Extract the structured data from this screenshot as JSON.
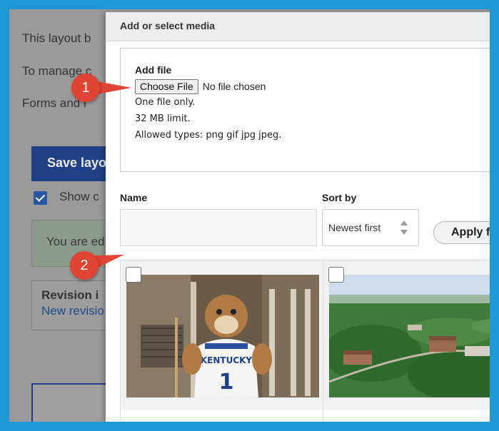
{
  "background": {
    "line1": "This layout b",
    "line2": "To manage c",
    "line3": "Forms and i",
    "save_label": "Save layo",
    "show_label": "Show c",
    "notice": "You are ed",
    "revision_title": "Revision i",
    "revision_link": "New revisio"
  },
  "modal": {
    "title": "Add or select media",
    "add_file_label": "Add file",
    "choose_file_label": "Choose File",
    "no_file_text": "No file chosen",
    "hints": [
      "One file only.",
      "32 MB limit.",
      "Allowed types: png gif jpg jpeg."
    ],
    "name_label": "Name",
    "name_value": "",
    "sort_label": "Sort by",
    "sort_value": "Newest first",
    "apply_label": "Apply fil",
    "media": [
      {
        "filename": "WildcatMascot.jpg",
        "checked": false
      },
      {
        "filename": "northcentral4h_0.jpg",
        "checked": false
      }
    ]
  },
  "callouts": [
    "1",
    "2"
  ],
  "colors": {
    "frame": "#1e97d4",
    "callout": "#e04434",
    "save_button": "#1f3f86"
  }
}
